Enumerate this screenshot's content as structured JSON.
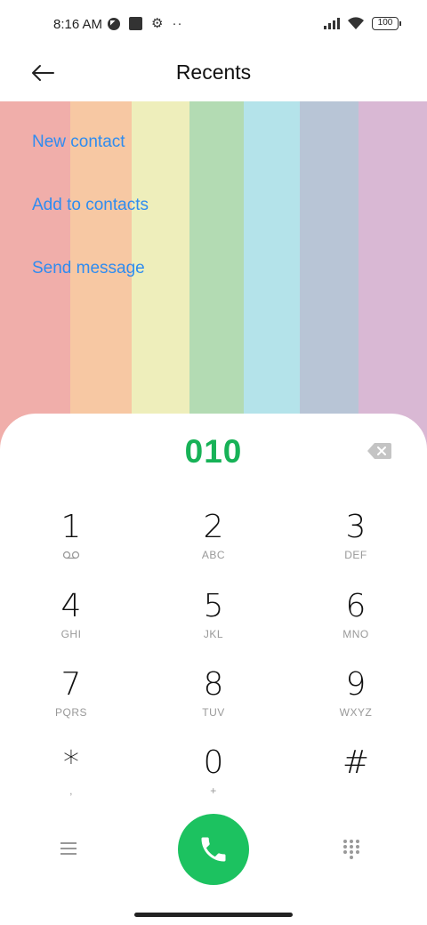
{
  "status_bar": {
    "time": "8:16 AM",
    "battery": "100",
    "icons": [
      "data-saver-icon",
      "square-notification-icon",
      "gear-icon",
      "more-dots-icon",
      "signal-icon",
      "wifi-icon",
      "battery-icon"
    ]
  },
  "header": {
    "title": "Recents",
    "back_icon": "arrow-left-icon"
  },
  "actions": [
    {
      "label": "New contact"
    },
    {
      "label": "Add to contacts"
    },
    {
      "label": "Send message"
    }
  ],
  "dialer": {
    "number": "010",
    "keys": [
      {
        "digit": "1",
        "letters": ""
      },
      {
        "digit": "2",
        "letters": "ABC"
      },
      {
        "digit": "3",
        "letters": "DEF"
      },
      {
        "digit": "4",
        "letters": "GHI"
      },
      {
        "digit": "5",
        "letters": "JKL"
      },
      {
        "digit": "6",
        "letters": "MNO"
      },
      {
        "digit": "7",
        "letters": "PQRS"
      },
      {
        "digit": "8",
        "letters": "TUV"
      },
      {
        "digit": "9",
        "letters": "WXYZ"
      },
      {
        "digit": "*",
        "letters": ","
      },
      {
        "digit": "0",
        "letters": "+"
      },
      {
        "digit": "#",
        "letters": ""
      }
    ]
  },
  "colors": {
    "accent_link": "#2f8cf0",
    "number_green": "#17b257",
    "call_green": "#1cc260",
    "rainbow": [
      "#f0aeaa",
      "#f7c8a3",
      "#eeeebb",
      "#b3dbb3",
      "#b4e3ea",
      "#b8c5d6",
      "#d9b8d4"
    ]
  }
}
